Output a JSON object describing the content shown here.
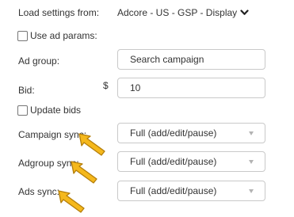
{
  "load_settings": {
    "label": "Load settings from:",
    "value": "Adcore - US - GSP - Display",
    "icon": "chevron-down-icon"
  },
  "use_ad_params": {
    "label": "Use ad params:",
    "checked": false
  },
  "ad_group": {
    "label": "Ad group:",
    "value": "Search campaign"
  },
  "bid": {
    "label": "Bid:",
    "currency": "$",
    "value": "10"
  },
  "update_bids": {
    "label": "Update bids",
    "checked": false
  },
  "campaign_sync": {
    "label": "Campaign sync:",
    "value": "Full (add/edit/pause)"
  },
  "adgroup_sync": {
    "label": "Adgroup sync:",
    "value": "Full (add/edit/pause)"
  },
  "ads_sync": {
    "label": "Ads sync:",
    "value": "Full (add/edit/pause)"
  },
  "colors": {
    "pointer_fill": "#f5b81c",
    "pointer_stroke": "#b47e0a",
    "border": "#c9c9c9",
    "text": "#333333"
  }
}
